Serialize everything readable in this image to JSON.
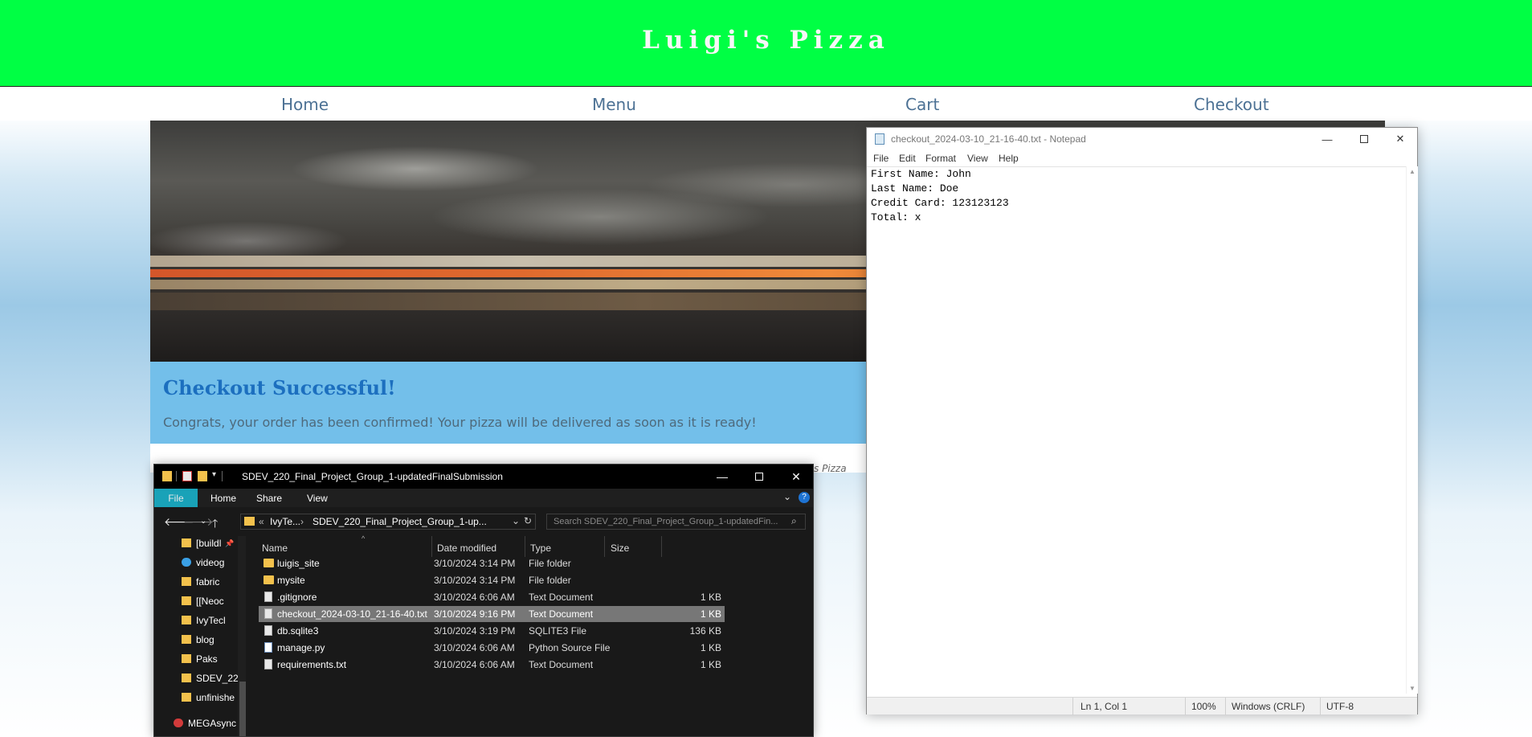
{
  "site": {
    "title": "Luigi's Pizza",
    "nav": [
      "Home",
      "Menu",
      "Cart",
      "Checkout"
    ],
    "success_title": "Checkout Successful!",
    "success_message": "Congrats, your order has been confirmed! Your pizza will be delivered as soon as it is ready!",
    "footer_fragment": "s Pizza",
    "colors": {
      "header_green": "#00ff44",
      "band_blue": "#73bfea",
      "title_blue": "#1c6fbf"
    }
  },
  "explorer": {
    "title": "SDEV_220_Final_Project_Group_1-updatedFinalSubmission",
    "ribbon_tabs": [
      "File",
      "Home",
      "Share",
      "View"
    ],
    "address_parts": [
      "«",
      "IvyTe...",
      "›",
      "SDEV_220_Final_Project_Group_1-up..."
    ],
    "search_placeholder": "Search SDEV_220_Final_Project_Group_1-updatedFin...",
    "sidebar": [
      {
        "label": "[buildl",
        "icon": "folder-icon"
      },
      {
        "label": "videog",
        "icon": "chrome-icon"
      },
      {
        "label": "fabric",
        "icon": "folder-icon"
      },
      {
        "label": "[[Neoc",
        "icon": "folder-icon"
      },
      {
        "label": "IvyTecl",
        "icon": "folder-icon"
      },
      {
        "label": "blog",
        "icon": "folder-icon"
      },
      {
        "label": "Paks",
        "icon": "folder-icon"
      },
      {
        "label": "SDEV_220",
        "icon": "folder-icon"
      },
      {
        "label": "unfinishe",
        "icon": "folder-icon"
      },
      {
        "label": "MEGAsync",
        "icon": "mega-icon"
      }
    ],
    "columns": [
      "Name",
      "Date modified",
      "Type",
      "Size"
    ],
    "files": [
      {
        "name": "luigis_site",
        "date": "3/10/2024 3:14 PM",
        "type": "File folder",
        "size": "",
        "icon": "folder-icon"
      },
      {
        "name": "mysite",
        "date": "3/10/2024 3:14 PM",
        "type": "File folder",
        "size": "",
        "icon": "folder-icon"
      },
      {
        "name": ".gitignore",
        "date": "3/10/2024 6:06 AM",
        "type": "Text Document",
        "size": "1 KB",
        "icon": "document-icon"
      },
      {
        "name": "checkout_2024-03-10_21-16-40.txt",
        "date": "3/10/2024 9:16 PM",
        "type": "Text Document",
        "size": "1 KB",
        "icon": "document-icon",
        "selected": true
      },
      {
        "name": "db.sqlite3",
        "date": "3/10/2024 3:19 PM",
        "type": "SQLITE3 File",
        "size": "136 KB",
        "icon": "document-icon"
      },
      {
        "name": "manage.py",
        "date": "3/10/2024 6:06 AM",
        "type": "Python Source File",
        "size": "1 KB",
        "icon": "python-file-icon"
      },
      {
        "name": "requirements.txt",
        "date": "3/10/2024 6:06 AM",
        "type": "Text Document",
        "size": "1 KB",
        "icon": "document-icon"
      }
    ]
  },
  "notepad": {
    "title": "checkout_2024-03-10_21-16-40.txt - Notepad",
    "menu": [
      "File",
      "Edit",
      "Format",
      "View",
      "Help"
    ],
    "lines": [
      "First Name: John",
      "Last Name: Doe",
      "Credit Card: 123123123",
      "Total: x"
    ],
    "status": {
      "position": "Ln 1, Col 1",
      "zoom": "100%",
      "line_ending": "Windows (CRLF)",
      "encoding": "UTF-8"
    }
  }
}
